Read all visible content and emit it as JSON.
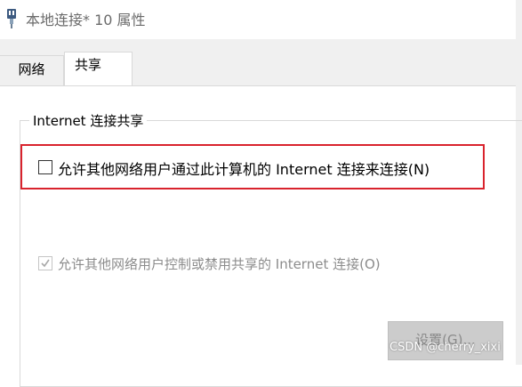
{
  "window": {
    "title": "本地连接* 10 属性",
    "icon": "network-adapter-icon"
  },
  "tabs": [
    {
      "label": "网络",
      "active": false
    },
    {
      "label": "共享",
      "active": true
    }
  ],
  "sharing": {
    "group_label": "Internet 连接共享",
    "allow_connect": {
      "label": "允许其他网络用户通过此计算机的 Internet 连接来连接(N)",
      "checked": false,
      "enabled": true
    },
    "allow_control": {
      "label": "允许其他网络用户控制或禁用共享的 Internet 连接(O)",
      "checked": true,
      "enabled": false
    },
    "settings_button": {
      "label": "设置(G)...",
      "enabled": false
    }
  },
  "watermark": "CSDN @cherry_xixi",
  "colors": {
    "highlight_border": "#d9232d",
    "disabled_text": "#8c8c8c",
    "tab_strip": "#f0f0f0"
  }
}
